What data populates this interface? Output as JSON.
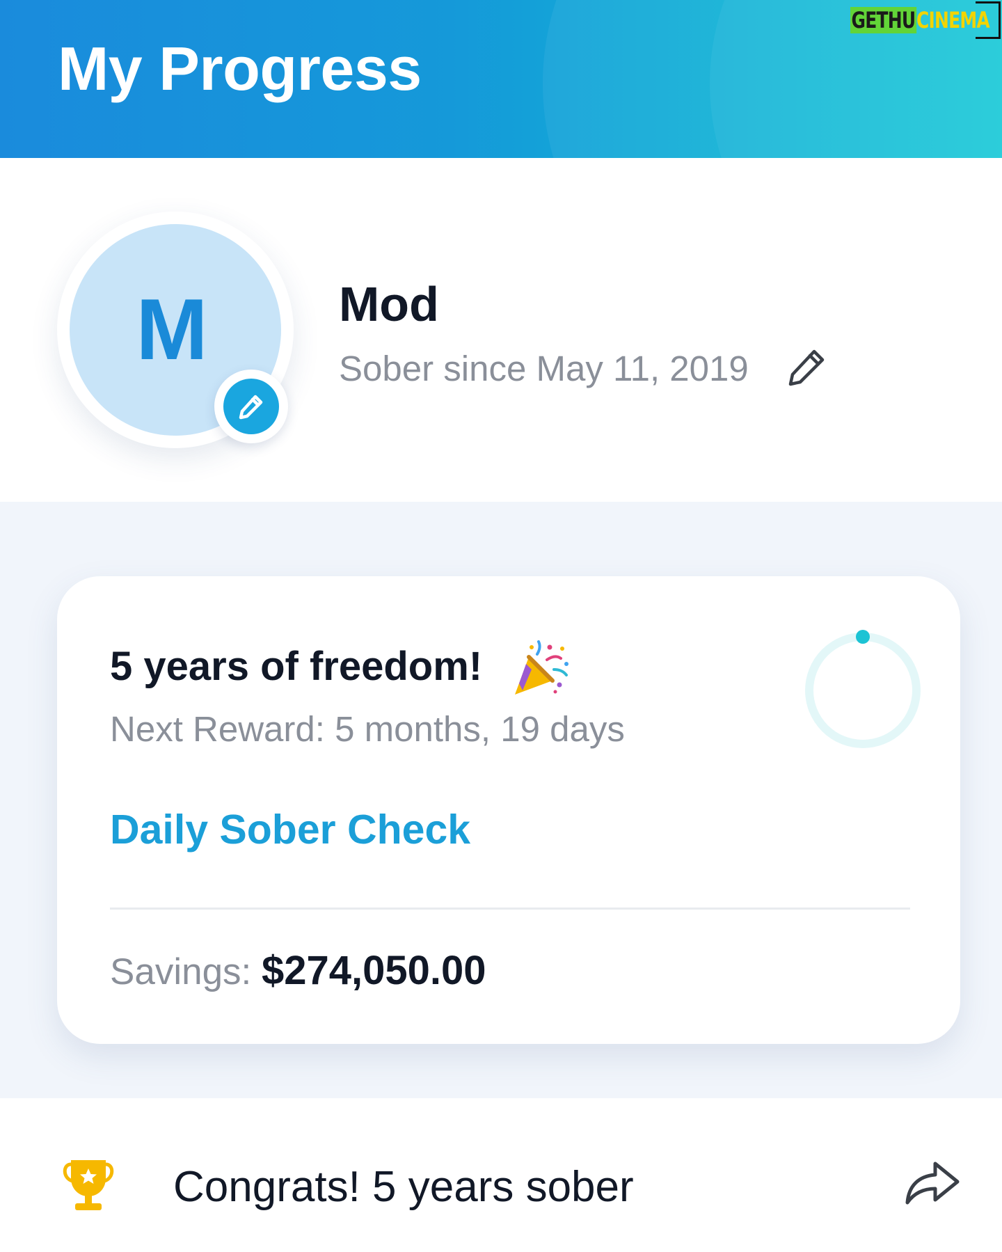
{
  "header": {
    "title": "My Progress"
  },
  "watermark": {
    "part1": "GETHU",
    "part2": "CINEMA"
  },
  "profile": {
    "initial": "M",
    "name": "Mod",
    "sober_since": "Sober since May 11, 2019"
  },
  "card": {
    "title": "5 years of freedom!",
    "next_reward": "Next Reward: 5 months, 19 days",
    "daily_check": "Daily Sober Check",
    "savings_label": "Savings:",
    "savings_value": "$274,050.00",
    "progress_fraction": 0.0
  },
  "footer": {
    "message": "Congrats! 5 years sober"
  },
  "colors": {
    "accent": "#1b9fd8",
    "header_start": "#1a8bdc",
    "header_end": "#14c8d6",
    "trophy": "#f6b800",
    "ring_track": "#e3f7f8",
    "ring_dot": "#1cc3d4"
  },
  "icons": {
    "avatar_edit": "pencil-icon",
    "sober_edit": "pencil-icon",
    "celebration": "party-popper-icon",
    "trophy": "trophy-icon",
    "share": "share-arrow-icon"
  }
}
